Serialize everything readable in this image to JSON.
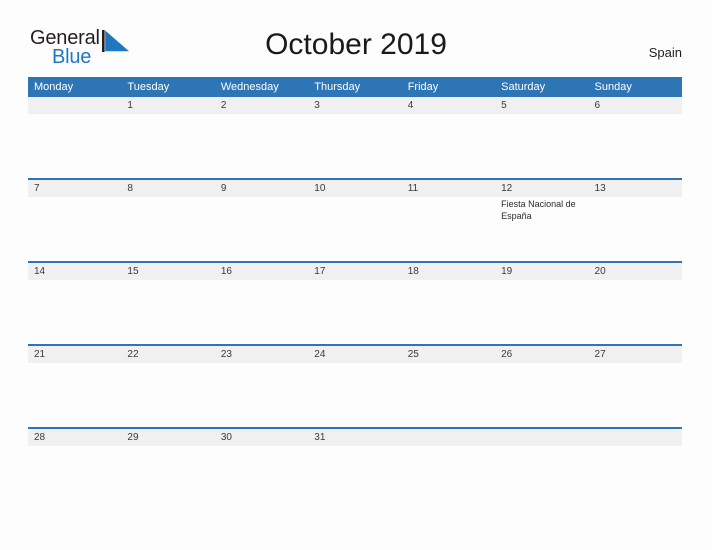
{
  "brand": {
    "name_part1": "General",
    "name_part2": "Blue",
    "flag_icon": "flag-triangle-icon",
    "color_primary": "#1F77C2",
    "color_text": "#231F20"
  },
  "header": {
    "title": "October 2019",
    "country": "Spain"
  },
  "theme": {
    "header_blue": "#2E75B6",
    "row_border_blue": "#2E75B6",
    "daynum_band_gray": "#F0F0F0",
    "page_background": "#FDFDFD",
    "text_dark": "#3A3A3A"
  },
  "calendar": {
    "weekday_headers": [
      "Monday",
      "Tuesday",
      "Wednesday",
      "Thursday",
      "Friday",
      "Saturday",
      "Sunday"
    ],
    "weeks": [
      {
        "days": [
          {
            "num": "",
            "events": []
          },
          {
            "num": "1",
            "events": []
          },
          {
            "num": "2",
            "events": []
          },
          {
            "num": "3",
            "events": []
          },
          {
            "num": "4",
            "events": []
          },
          {
            "num": "5",
            "events": []
          },
          {
            "num": "6",
            "events": []
          }
        ]
      },
      {
        "days": [
          {
            "num": "7",
            "events": []
          },
          {
            "num": "8",
            "events": []
          },
          {
            "num": "9",
            "events": []
          },
          {
            "num": "10",
            "events": []
          },
          {
            "num": "11",
            "events": []
          },
          {
            "num": "12",
            "events": [
              "Fiesta Nacional de España"
            ]
          },
          {
            "num": "13",
            "events": []
          }
        ]
      },
      {
        "days": [
          {
            "num": "14",
            "events": []
          },
          {
            "num": "15",
            "events": []
          },
          {
            "num": "16",
            "events": []
          },
          {
            "num": "17",
            "events": []
          },
          {
            "num": "18",
            "events": []
          },
          {
            "num": "19",
            "events": []
          },
          {
            "num": "20",
            "events": []
          }
        ]
      },
      {
        "days": [
          {
            "num": "21",
            "events": []
          },
          {
            "num": "22",
            "events": []
          },
          {
            "num": "23",
            "events": []
          },
          {
            "num": "24",
            "events": []
          },
          {
            "num": "25",
            "events": []
          },
          {
            "num": "26",
            "events": []
          },
          {
            "num": "27",
            "events": []
          }
        ]
      },
      {
        "days": [
          {
            "num": "28",
            "events": []
          },
          {
            "num": "29",
            "events": []
          },
          {
            "num": "30",
            "events": []
          },
          {
            "num": "31",
            "events": []
          },
          {
            "num": "",
            "events": []
          },
          {
            "num": "",
            "events": []
          },
          {
            "num": "",
            "events": []
          }
        ]
      }
    ]
  }
}
